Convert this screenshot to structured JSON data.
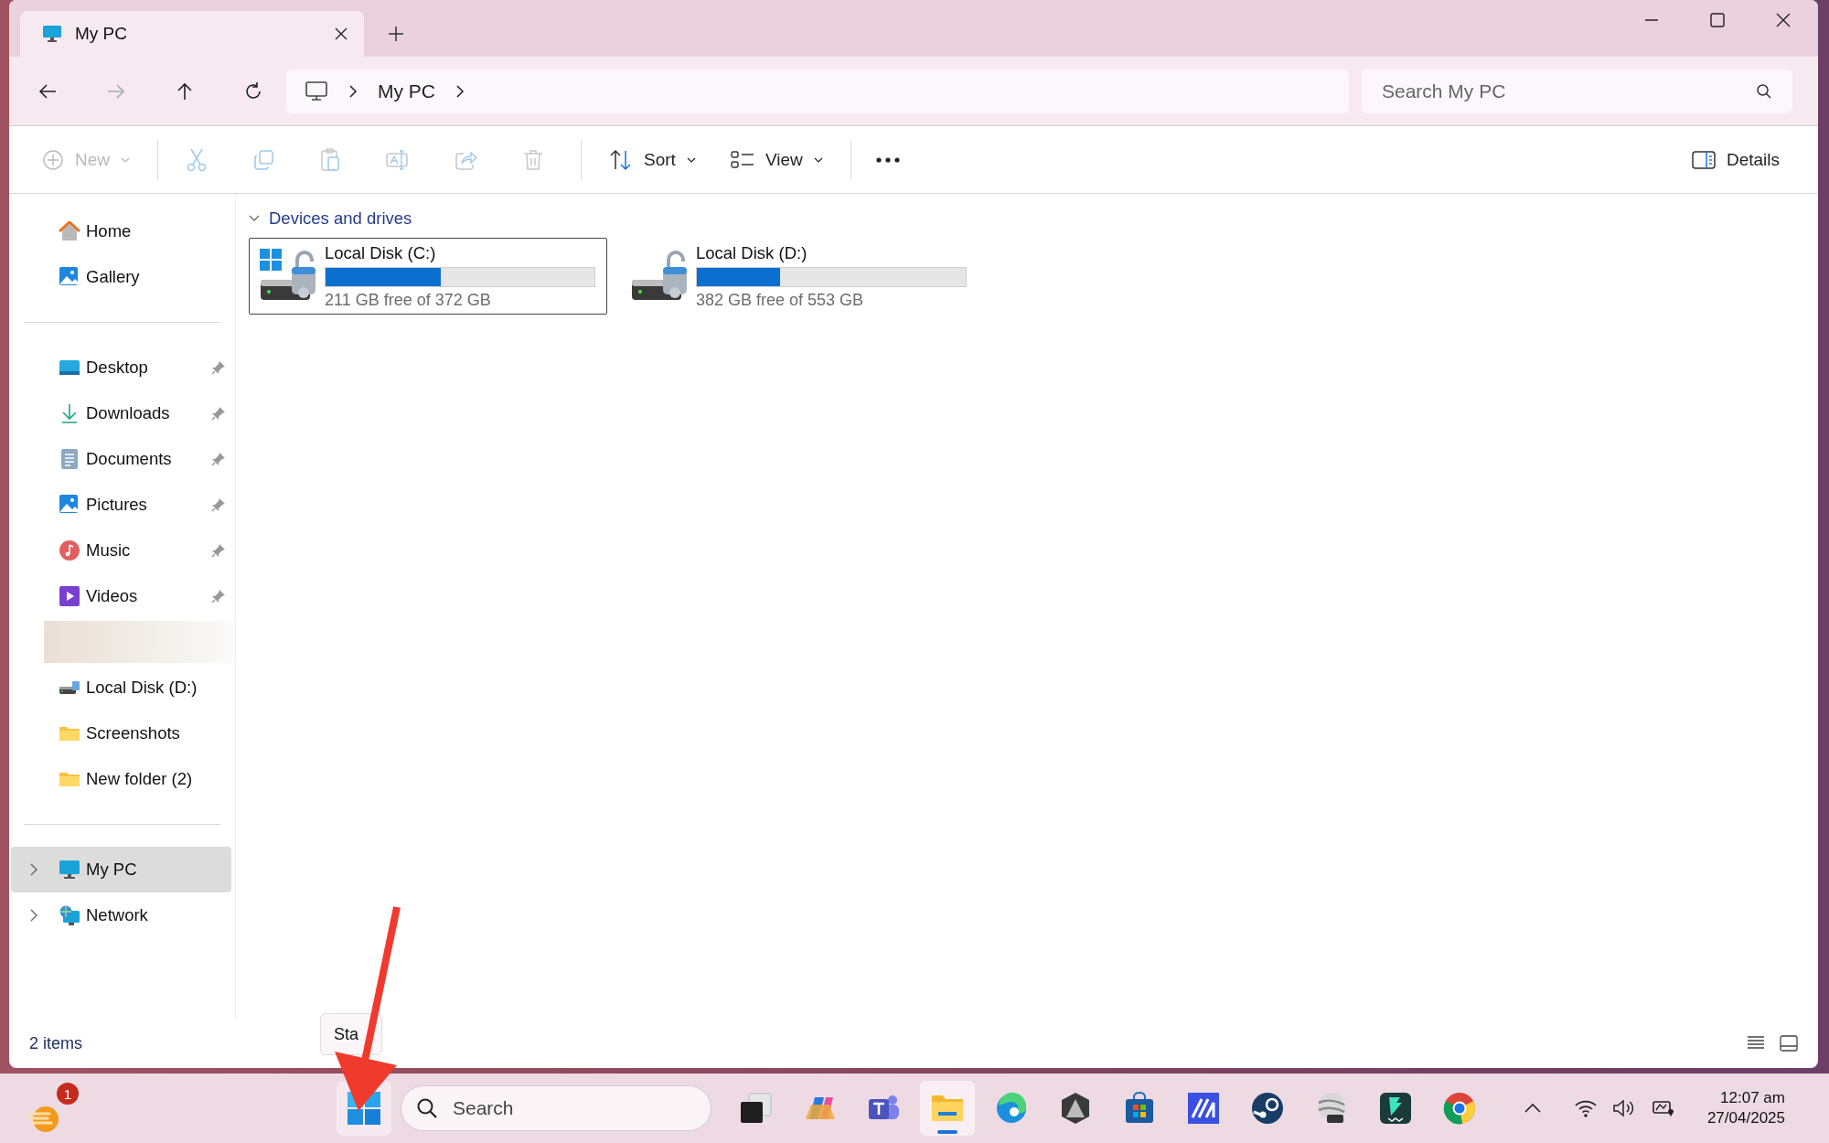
{
  "tabs": [
    {
      "title": "My PC",
      "selected": true
    }
  ],
  "nav": {
    "breadcrumb": [
      "My PC"
    ],
    "search": {
      "placeholder": "Search My PC"
    }
  },
  "toolbar": {
    "buttons": [
      {
        "kind": "new",
        "label": "New",
        "disabled": true
      },
      {
        "kind": "cut",
        "disabled": true
      },
      {
        "kind": "copy",
        "disabled": true
      },
      {
        "kind": "paste",
        "disabled": true
      },
      {
        "kind": "rename",
        "disabled": true
      },
      {
        "kind": "share",
        "disabled": true
      },
      {
        "kind": "delete",
        "disabled": true
      },
      {
        "kind": "sort",
        "label": "Sort",
        "disabled": false
      },
      {
        "kind": "view",
        "label": "View",
        "disabled": false
      }
    ],
    "details": "Details"
  },
  "sidebar": {
    "groups": [
      [
        {
          "kind": "home",
          "label": "Home",
          "selected": false
        },
        {
          "kind": "gallery",
          "label": "Gallery",
          "selected": false
        }
      ],
      [
        {
          "kind": "desktop",
          "label": "Desktop",
          "pinned": true,
          "selected": false
        },
        {
          "kind": "downloads",
          "label": "Downloads",
          "pinned": true,
          "selected": false
        },
        {
          "kind": "documents",
          "label": "Documents",
          "pinned": true,
          "selected": false
        },
        {
          "kind": "pictures",
          "label": "Pictures",
          "pinned": true,
          "selected": false
        },
        {
          "kind": "music",
          "label": "Music",
          "pinned": true,
          "selected": false
        },
        {
          "kind": "videos",
          "label": "Videos",
          "pinned": true,
          "selected": false
        },
        {
          "kind": "redacted"
        },
        {
          "kind": "drive",
          "label": "Local Disk (D:)",
          "pinned": false,
          "selected": false
        },
        {
          "kind": "folder",
          "label": "Screenshots",
          "pinned": false,
          "selected": false
        },
        {
          "kind": "folder",
          "label": "New folder (2)",
          "pinned": false,
          "selected": false
        }
      ],
      [
        {
          "kind": "pc",
          "label": "My PC",
          "selected": true
        },
        {
          "kind": "network",
          "label": "Network",
          "selected": false
        }
      ]
    ]
  },
  "section": {
    "title": "Devices and drives",
    "expanded": true
  },
  "drives": [
    {
      "name": "Local Disk (C:)",
      "system": true,
      "level": 0.43,
      "free": "211 GB free of 372 GB",
      "selected": true
    },
    {
      "name": "Local Disk (D:)",
      "system": false,
      "level": 0.31,
      "free": "382 GB free of 553 GB",
      "selected": false
    }
  ],
  "status_bar": {
    "count": "2 items"
  },
  "tooltip": "Sta",
  "taskbar": {
    "badge": "1",
    "search": "Search",
    "apps": [
      {
        "kind": "taskview",
        "selected": false
      },
      {
        "kind": "copilot",
        "selected": false
      },
      {
        "kind": "teams",
        "selected": false
      },
      {
        "kind": "explorer",
        "selected": true
      },
      {
        "kind": "edge",
        "selected": false
      },
      {
        "kind": "hex",
        "selected": false
      },
      {
        "kind": "store",
        "selected": false
      },
      {
        "kind": "ma",
        "selected": false
      },
      {
        "kind": "steam",
        "selected": false
      },
      {
        "kind": "globe",
        "selected": false
      },
      {
        "kind": "filmora",
        "selected": false
      },
      {
        "kind": "chrome",
        "selected": false
      }
    ],
    "time": "12:07 am",
    "date": "27/04/2025"
  }
}
